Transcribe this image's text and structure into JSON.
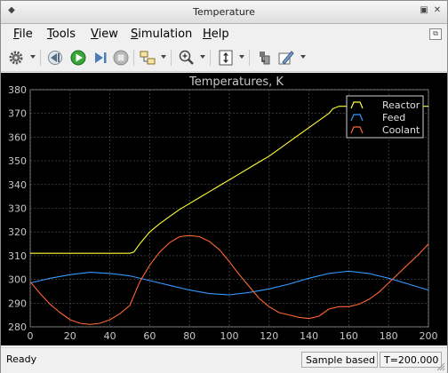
{
  "window": {
    "title": "Temperature"
  },
  "menu": {
    "items": [
      {
        "label": "File",
        "mnemonic": "F",
        "rest": "ile"
      },
      {
        "label": "Tools",
        "mnemonic": "T",
        "rest": "ools"
      },
      {
        "label": "View",
        "mnemonic": "V",
        "rest": "iew"
      },
      {
        "label": "Simulation",
        "mnemonic": "S",
        "rest": "imulation"
      },
      {
        "label": "Help",
        "mnemonic": "H",
        "rest": "elp"
      }
    ]
  },
  "toolbar": {
    "buttons": [
      {
        "name": "settings-icon"
      },
      {
        "name": "step-back-icon"
      },
      {
        "name": "run-icon"
      },
      {
        "name": "step-forward-icon"
      },
      {
        "name": "stop-icon"
      },
      {
        "name": "highlight-block-icon"
      },
      {
        "name": "zoom-icon"
      },
      {
        "name": "scale-axes-icon"
      },
      {
        "name": "save-axes-limits-icon"
      },
      {
        "name": "style-icon"
      }
    ]
  },
  "colors": {
    "reactor": "#ffff33",
    "feed": "#3399ff",
    "coolant": "#ff6633",
    "axes_bg": "#000000",
    "figure_bg": "#000000",
    "grid": "#5a5a5a",
    "text": "#c8c8c8"
  },
  "status": {
    "left": "Ready",
    "mode": "Sample based",
    "time": "T=200.000"
  },
  "chart_data": {
    "type": "line",
    "title": "Temperatures, K",
    "xlabel": "",
    "ylabel": "",
    "xlim": [
      0,
      200
    ],
    "ylim": [
      280,
      380
    ],
    "xticks": [
      0,
      20,
      40,
      60,
      80,
      100,
      120,
      140,
      160,
      180,
      200
    ],
    "yticks": [
      280,
      290,
      300,
      310,
      320,
      330,
      340,
      350,
      360,
      370,
      380
    ],
    "grid": true,
    "legend_position": "top-right",
    "series": [
      {
        "name": "Reactor",
        "x": [
          0,
          10,
          20,
          30,
          40,
          50,
          52,
          55,
          60,
          65,
          70,
          75,
          80,
          85,
          90,
          95,
          100,
          105,
          110,
          115,
          120,
          125,
          130,
          135,
          140,
          145,
          150,
          152,
          155,
          160,
          170,
          180,
          190,
          200
        ],
        "y": [
          311,
          311,
          311,
          311,
          311,
          311,
          311.5,
          315,
          320,
          323.5,
          326.5,
          329.5,
          332,
          334.5,
          337,
          339.5,
          342,
          344.5,
          347,
          349.5,
          352,
          355,
          358,
          361,
          364,
          367,
          370,
          372,
          373,
          373,
          373,
          373,
          373,
          373
        ]
      },
      {
        "name": "Feed",
        "x": [
          0,
          10,
          20,
          30,
          40,
          50,
          60,
          70,
          80,
          90,
          100,
          110,
          120,
          130,
          140,
          150,
          160,
          170,
          180,
          190,
          200
        ],
        "y": [
          298.5,
          300.5,
          302,
          303,
          302.5,
          301.5,
          299.5,
          297.5,
          295.5,
          294,
          293.5,
          294.5,
          296,
          298,
          300.5,
          302.5,
          303.5,
          302.5,
          300.5,
          298,
          295.5
        ]
      },
      {
        "name": "Coolant",
        "x": [
          0,
          5,
          10,
          15,
          20,
          25,
          30,
          35,
          40,
          45,
          50,
          52,
          55,
          60,
          65,
          70,
          75,
          80,
          85,
          90,
          95,
          100,
          105,
          110,
          115,
          120,
          125,
          130,
          135,
          140,
          145,
          150,
          155,
          160,
          165,
          170,
          175,
          180,
          185,
          190,
          195,
          200
        ],
        "y": [
          299,
          294,
          289.5,
          286,
          283,
          281.5,
          281,
          281.5,
          283,
          285.5,
          289,
          293,
          299,
          306,
          311.5,
          315.5,
          318,
          318.5,
          318,
          316,
          312.5,
          307.5,
          302,
          297,
          292,
          288.5,
          286,
          285,
          284,
          283.5,
          284.5,
          287.5,
          288.5,
          288.5,
          289.5,
          291.5,
          294.5,
          298.5,
          302.5,
          306.5,
          310.5,
          315
        ]
      }
    ]
  }
}
